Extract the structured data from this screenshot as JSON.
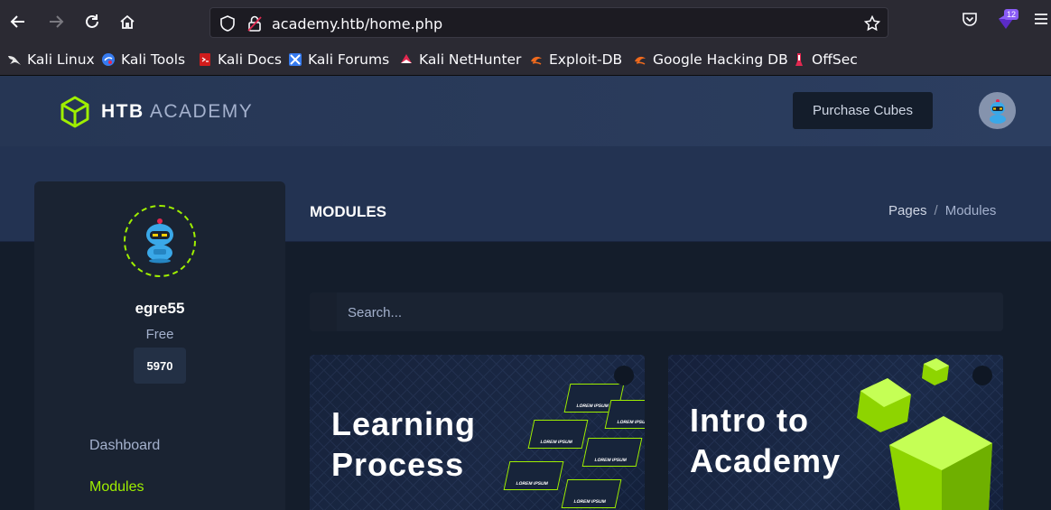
{
  "browser": {
    "url": "academy.htb/home.php",
    "extension_badge": "12",
    "bookmarks": [
      {
        "label": "Kali Linux",
        "icon": "kali-dragon-icon"
      },
      {
        "label": "Kali Tools",
        "icon": "kali-tools-icon"
      },
      {
        "label": "Kali Docs",
        "icon": "kali-docs-icon"
      },
      {
        "label": "Kali Forums",
        "icon": "kali-forums-icon"
      },
      {
        "label": "Kali NetHunter",
        "icon": "kali-nethunter-icon"
      },
      {
        "label": "Exploit-DB",
        "icon": "exploit-db-icon"
      },
      {
        "label": "Google Hacking DB",
        "icon": "exploit-db-icon"
      },
      {
        "label": "OffSec",
        "icon": "offsec-icon"
      }
    ]
  },
  "header": {
    "logo_bold": "HTB",
    "logo_light": "ACADEMY",
    "purchase_label": "Purchase Cubes"
  },
  "page": {
    "title": "MODULES",
    "breadcrumb": [
      "Pages",
      "Modules"
    ]
  },
  "sidebar": {
    "username": "egre55",
    "plan": "Free",
    "cubes": "5970",
    "nav": [
      {
        "label": "Dashboard",
        "active": false
      },
      {
        "label": "Modules",
        "active": true
      }
    ]
  },
  "search": {
    "placeholder": "Search..."
  },
  "modules": [
    {
      "title_line1": "Learning",
      "title_line2": "Process",
      "tile_text": "LOREM IPSUM"
    },
    {
      "title_line1": "Intro to",
      "title_line2": "Academy"
    }
  ],
  "colors": {
    "accent": "#9fef00",
    "bg": "#141d2b",
    "panel": "#1a2332",
    "header": "#27375a"
  }
}
